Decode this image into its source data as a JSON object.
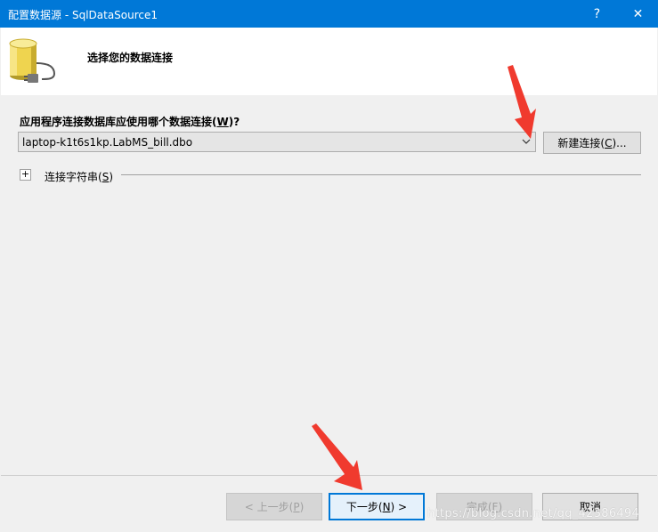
{
  "window": {
    "title": "配置数据源 - SqlDataSource1",
    "help_label": "?",
    "close_label": "✕"
  },
  "header": {
    "title": "选择您的数据连接"
  },
  "form": {
    "question_text": "应用程序连接数据库应使用哪个数据连接(",
    "question_key": "W",
    "question_suffix": ")?",
    "connection_value": "laptop-k1t6s1kp.LabMS_bill.dbo",
    "new_connection_text": "新建连接(",
    "new_connection_key": "C",
    "new_connection_suffix": ")...",
    "expand_symbol": "+",
    "connection_string_text": "连接字符串(",
    "connection_string_key": "S",
    "connection_string_suffix": ")"
  },
  "footer": {
    "back_text": "< 上一步(",
    "back_key": "P",
    "back_suffix": ")",
    "next_text": "下一步(",
    "next_key": "N",
    "next_suffix": ") >",
    "finish_text": "完成(",
    "finish_key": "F",
    "finish_suffix": ")",
    "cancel_label": "取消"
  },
  "watermark": "https://blog.csdn.net/qq_42386494",
  "colors": {
    "titlebar": "#0078d7",
    "annotation_arrow": "#f03a2e"
  }
}
